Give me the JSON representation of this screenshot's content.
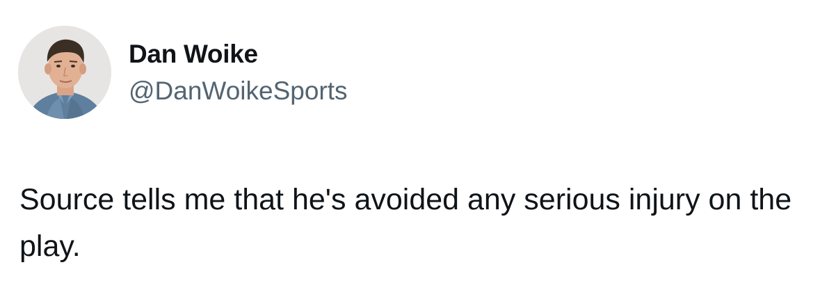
{
  "author": {
    "display_name": "Dan Woike",
    "handle": "@DanWoikeSports",
    "avatar_icon": "profile-photo"
  },
  "tweet": {
    "text": "Source tells me that he's avoided any serious injury on the play."
  },
  "colors": {
    "text_primary": "#0f1419",
    "text_secondary": "#536471",
    "background": "#ffffff"
  }
}
